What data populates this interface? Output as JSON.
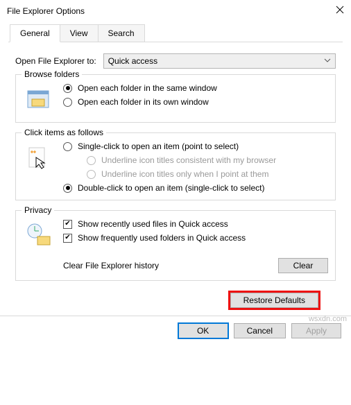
{
  "window": {
    "title": "File Explorer Options"
  },
  "tabs": {
    "general": "General",
    "view": "View",
    "search": "Search"
  },
  "open_to": {
    "label": "Open File Explorer to:",
    "value": "Quick access"
  },
  "browse": {
    "legend": "Browse folders",
    "same": "Open each folder in the same window",
    "own": "Open each folder in its own window"
  },
  "click": {
    "legend": "Click items as follows",
    "single": "Single-click to open an item (point to select)",
    "u_browser": "Underline icon titles consistent with my browser",
    "u_point": "Underline icon titles only when I point at them",
    "double": "Double-click to open an item (single-click to select)"
  },
  "privacy": {
    "legend": "Privacy",
    "recent": "Show recently used files in Quick access",
    "freq": "Show frequently used folders in Quick access",
    "clear_label": "Clear File Explorer history",
    "clear_btn": "Clear"
  },
  "restore": "Restore Defaults",
  "footer": {
    "ok": "OK",
    "cancel": "Cancel",
    "apply": "Apply"
  },
  "watermark": "wsxdn.com"
}
